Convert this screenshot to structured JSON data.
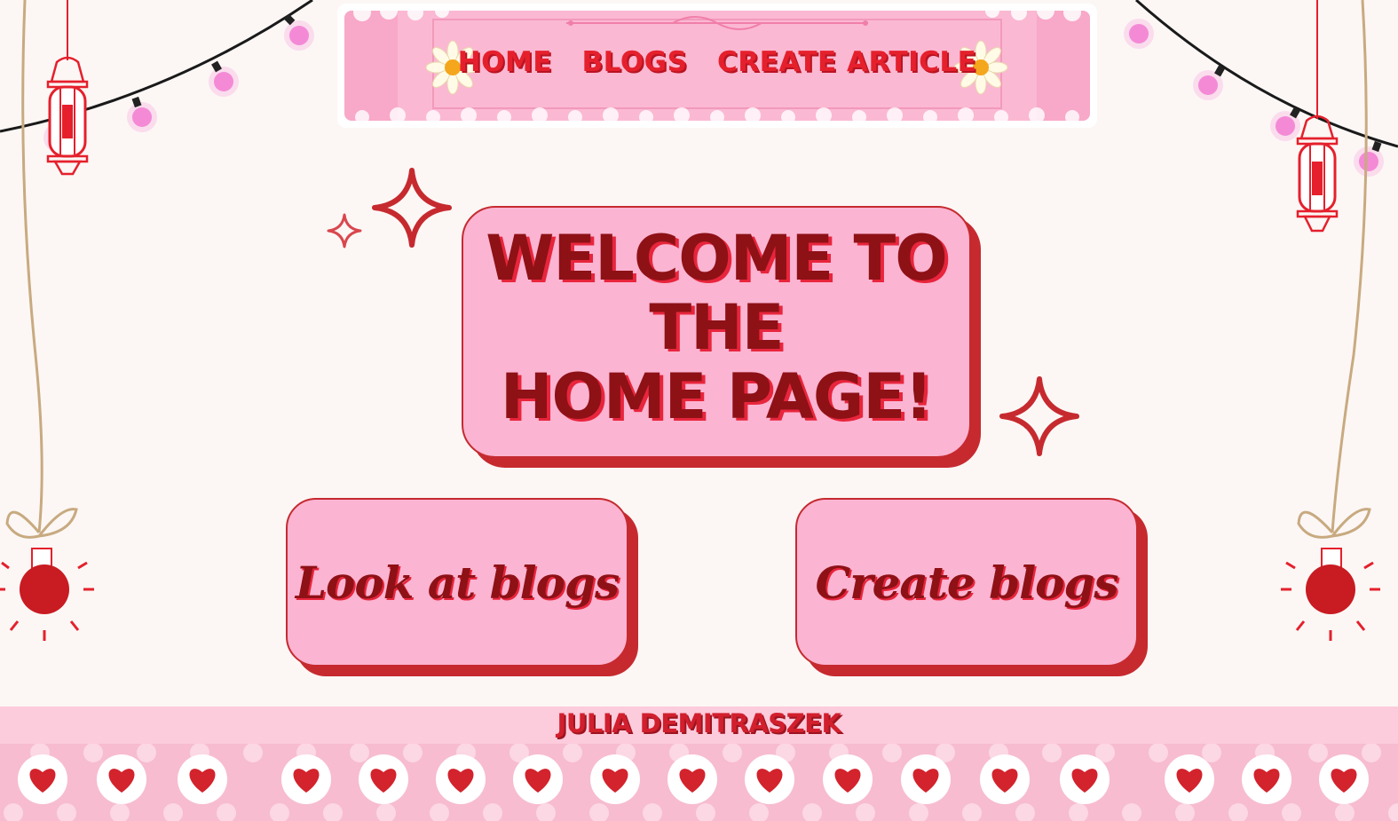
{
  "nav": {
    "links": [
      {
        "label": "HOME"
      },
      {
        "label": "BLOGS"
      },
      {
        "label": "CREATE ARTICLE"
      }
    ]
  },
  "welcome": {
    "line1": "WELCOME TO THE",
    "line2": "HOME PAGE!"
  },
  "actions": {
    "look_label": "Look at blogs",
    "create_label": "Create blogs"
  },
  "footer": {
    "author": "JULIA DEMITRASZEK"
  },
  "colors": {
    "background": "#fcf7f5",
    "card_pink": "#fbb4d2",
    "accent_red": "#c62a2f",
    "title_dark_red": "#8e1116",
    "nav_red": "#e5202c",
    "lights_pink": "#f07fd0"
  },
  "icons": [
    "lantern-icon",
    "sparkle-icon",
    "daisy-icon",
    "heart-icon",
    "ornament-icon",
    "string-lights"
  ]
}
